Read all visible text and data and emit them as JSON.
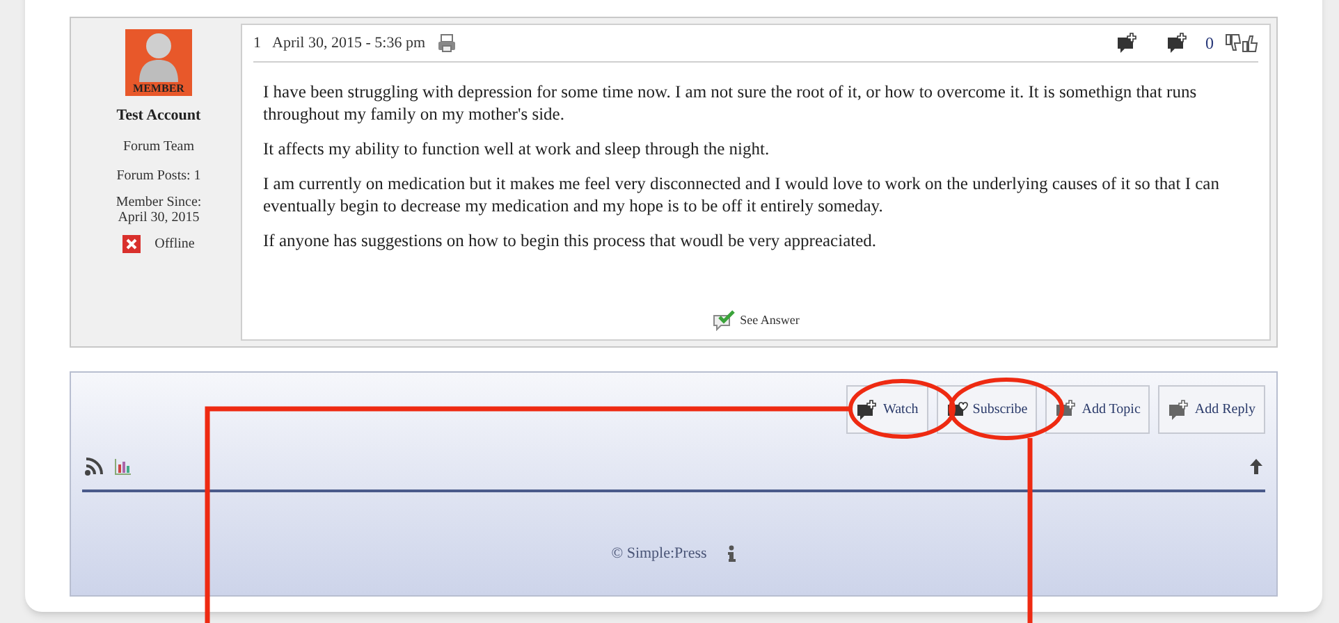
{
  "author": {
    "avatar_label": "MEMBER",
    "name": "Test Account",
    "role": "Forum Team",
    "posts": "Forum Posts: 1",
    "member_since": "Member Since: April 30, 2015",
    "status": "Offline",
    "online": false
  },
  "post": {
    "number": "1",
    "date": "April 30, 2015 - 5:36 pm",
    "vote_count": "0",
    "paragraphs": [
      "I have been struggling with depression for some time now. I am not sure the root of it, or how to overcome it. It is somethign that runs throughout my family on my mother's side.",
      "It affects my ability to function well at work and sleep through the night.",
      "I am currently on medication but it makes me feel very disconnected and I would love to work on the underlying causes of it so that I can eventually begin to decrease my medication and my hope is to be off it entirely someday.",
      "If anyone has suggestions on how to begin this process that woudl be very appreaciated."
    ],
    "answer_label": "See Answer"
  },
  "toolbar": {
    "buttons": [
      {
        "kind": "watch",
        "label": "Watch"
      },
      {
        "kind": "subscribe",
        "label": "Subscribe"
      },
      {
        "kind": "add",
        "label": "Add Topic"
      },
      {
        "kind": "add",
        "label": "Add Reply"
      }
    ]
  },
  "footer": {
    "copyright": "© Simple:Press"
  }
}
